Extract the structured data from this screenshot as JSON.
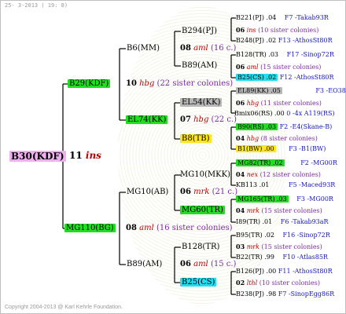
{
  "header": "25- 3-2013 ( 19: 8)",
  "footer": "Copyright 2004-2013 @ Karl Kehrle Foundation.",
  "root": {
    "name": "B30(KDF)",
    "gen": "11",
    "type": "ins"
  },
  "g2": [
    {
      "name": "B29(KDF)",
      "gen": "10",
      "type": "hbg",
      "sis": "(22 sister colonies)"
    },
    {
      "name": "MG110(BG)",
      "gen": "08",
      "type": "aml",
      "sis": "(16 sister colonies)"
    }
  ],
  "g3": [
    {
      "name": "B6(MM)"
    },
    {
      "name": "EL74(KK)",
      "gen": "07",
      "type": "hbg",
      "sis": "(22 c.)"
    },
    {
      "name": "MG10(AB)",
      "gen": "06",
      "type": "mrk",
      "sis": "(21 c.)"
    },
    {
      "name": "B89(AM)"
    }
  ],
  "g4": [
    {
      "name": "B294(PJ)",
      "gen": "08",
      "type": "aml",
      "sis": "(16 c.)"
    },
    {
      "name": "B89(AM)"
    },
    {
      "name": "EL54(KK)"
    },
    {
      "name": "B8(TB)"
    },
    {
      "name": "MG10(MKK)",
      "gen": "06",
      "type": "mrk",
      "sis": "(21 c.)"
    },
    {
      "name": "MG60(TR)"
    },
    {
      "name": "B128(TR)",
      "gen": "06",
      "type": "aml",
      "sis": "(15 c.)"
    },
    {
      "name": "B25(CS)"
    }
  ],
  "g4_mid": [
    {
      "gen": "06",
      "type": "hbg",
      "sis": "(11 sister colonies)"
    },
    {
      "gen": "04",
      "type": "hbg",
      "sis": "(8 sister colonies)"
    },
    {
      "gen": "04",
      "type": "mrk",
      "sis": "(15 sister colonies)"
    },
    {
      "gen": "03",
      "type": "mrk",
      "sis": "(15 sister colonies)"
    }
  ],
  "g5": [
    {
      "text": "B221(PJ) .04",
      "code": "F7 -Takab93R"
    },
    {
      "gen": "06",
      "type": "ins",
      "sis": "(10 sister colonies)"
    },
    {
      "text": "B248(PJ) .02",
      "code": "F13 -AthosSt80R"
    },
    {
      "text": "B128(TR) .03",
      "code": "F17 -Sinop72R"
    },
    {
      "gen": "06",
      "type": "aml",
      "sis": "(15 sister colonies)"
    },
    {
      "text": "B25(CS) .02",
      "code": "F12 -AthosSt80R"
    },
    {
      "text": "EL89(KK) .05",
      "code": "F3 -EO386"
    },
    {
      "text": "Bmix06(RS) .00",
      "code": "0 -4x A119(RS)"
    },
    {
      "text": "B90(RS) .03",
      "code": "F2 -E4(Skane-B)"
    },
    {
      "text": "B1(BW) .00",
      "code": "F3 -B1(BW)"
    },
    {
      "text": "MG82(TR) .02",
      "code": "F2 -MG00R"
    },
    {
      "gen": "04",
      "type": "nex",
      "sis": "(12 sister colonies)"
    },
    {
      "text": "KB113 .01",
      "code": "F5 -Maced93R"
    },
    {
      "text": "MG165(TR) .03",
      "code": "F3 -MG00R"
    },
    {
      "text": "I89(TR) .01",
      "code": "F6 -Takab93aR"
    },
    {
      "text": "B95(TR) .02",
      "code": "F16 -Sinop72R"
    },
    {
      "text": "B22(TR) .99",
      "code": "F10 -Atlas85R"
    },
    {
      "text": "B126(PJ) .00",
      "code": "F11 -AthosSt80R"
    },
    {
      "gen": "02",
      "type": "lthl",
      "sis": "(10 sister colonies)"
    },
    {
      "text": "B238(PJ) .98",
      "code": "F7 -SinopEgg86R"
    }
  ],
  "g5_type_of_b221": {
    "gen": "06",
    "type": "ins"
  }
}
